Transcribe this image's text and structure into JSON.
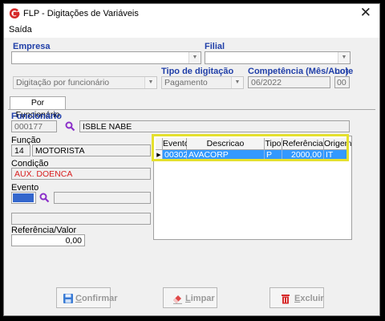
{
  "window": {
    "title": "FLP - Digitações de Variáveis",
    "close_glyph": "✕"
  },
  "menu": {
    "saida": "Saída"
  },
  "fields": {
    "empresa_label": "Empresa",
    "filial_label": "Filial",
    "digitacao_value": "Digitação por funcionário",
    "tipo_label": "Tipo de digitação",
    "tipo_value": "Pagamento",
    "competencia_label": "Competência (Mês/Ano)",
    "competencia_value": "06/2022",
    "lote_label": "Lote",
    "lote_value": "00"
  },
  "tab": {
    "label": "Por Funcionário"
  },
  "funcionario": {
    "label": "Funcionário",
    "code": "000177",
    "name": "ISBLE NABE",
    "funcao_label": "Função",
    "funcao_code": "14",
    "funcao_name": "MOTORISTA",
    "condicao_label": "Condição",
    "condicao_value": "AUX. DOENCA",
    "evento_label": "Evento",
    "referencia_label": "Referência/Valor",
    "referencia_value": "0,00"
  },
  "grid": {
    "columns": [
      "Evento",
      "Descricao",
      "Tipo",
      "Referência",
      "Origem"
    ],
    "rows": [
      {
        "evento": "00302",
        "descricao": "AVACORP",
        "tipo": "P",
        "referencia": "2000,00",
        "origem": "IT"
      }
    ],
    "selection_color": "#3399ff"
  },
  "buttons": {
    "confirmar_first": "C",
    "confirmar_rest": "onfirmar",
    "limpar_first": "L",
    "limpar_rest": "impar",
    "excluir_first": "E",
    "excluir_rest": "xcluir"
  },
  "colors": {
    "label_blue": "#1f3ea8",
    "condicao_red": "#d81e1e",
    "highlight": "#e5e02e",
    "brand_red": "#d62a2a"
  }
}
